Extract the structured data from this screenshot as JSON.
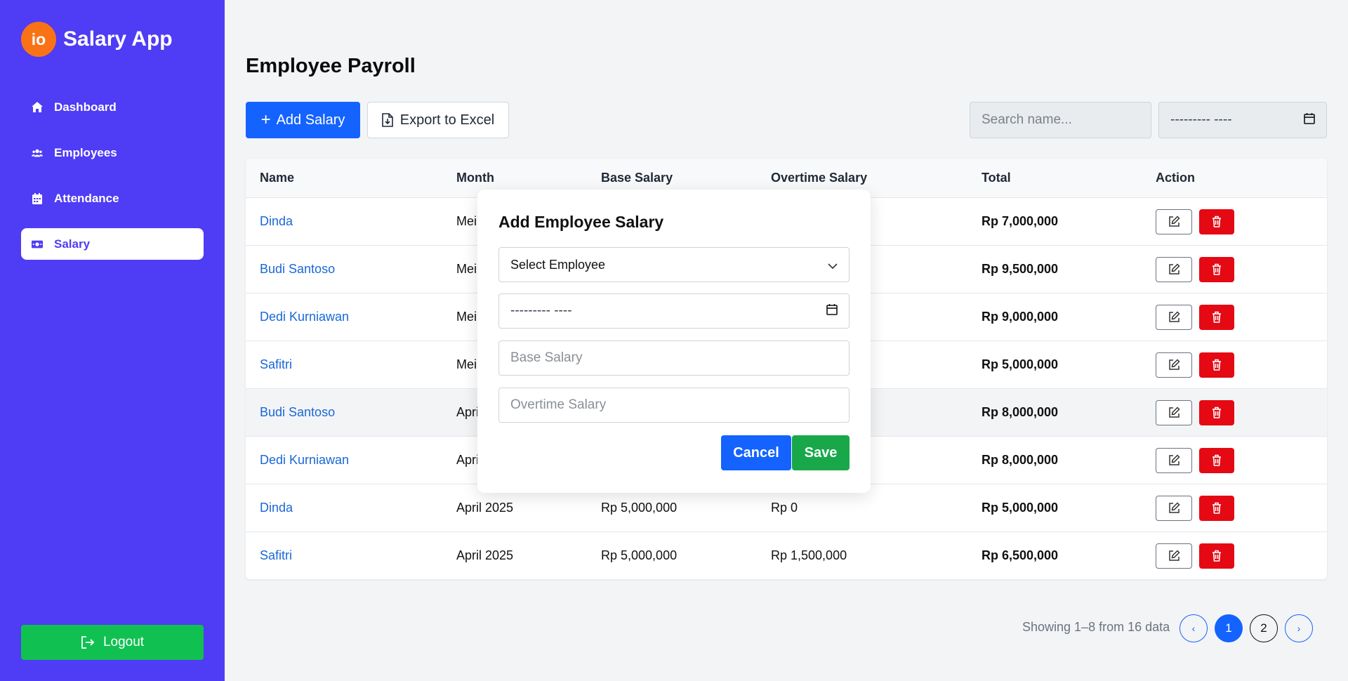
{
  "app": {
    "logo_text": "io",
    "title": "Salary App"
  },
  "sidebar": {
    "items": [
      {
        "label": "Dashboard",
        "icon": "home-icon",
        "active": false
      },
      {
        "label": "Employees",
        "icon": "users-icon",
        "active": false
      },
      {
        "label": "Attendance",
        "icon": "calendar-icon",
        "active": false
      },
      {
        "label": "Salary",
        "icon": "money-icon",
        "active": true
      }
    ],
    "logout_label": "Logout"
  },
  "page": {
    "title": "Employee Payroll"
  },
  "toolbar": {
    "add_label": "Add Salary",
    "export_label": "Export to Excel",
    "search_placeholder": "Search name...",
    "month_filter_value": "--------- ----"
  },
  "table": {
    "headers": [
      "Name",
      "Month",
      "Base Salary",
      "Overtime Salary",
      "Total",
      "Action"
    ],
    "rows": [
      {
        "name": "Dinda",
        "month": "Mei",
        "total": "Rp 7,000,000"
      },
      {
        "name": "Budi Santoso",
        "month": "Mei",
        "total": "Rp 9,500,000"
      },
      {
        "name": "Dedi Kurniawan",
        "month": "Mei",
        "total": "Rp 9,000,000"
      },
      {
        "name": "Safitri",
        "month": "Mei",
        "total": "Rp 5,000,000"
      },
      {
        "name": "Budi Santoso",
        "month": "Apri",
        "total": "Rp 8,000,000"
      },
      {
        "name": "Dedi Kurniawan",
        "month": "Apri",
        "total": "Rp 8,000,000"
      },
      {
        "name": "Dinda",
        "month": "April 2025",
        "base": "Rp 5,000,000",
        "overtime": "Rp 0",
        "total": "Rp 5,000,000"
      },
      {
        "name": "Safitri",
        "month": "April 2025",
        "base": "Rp 5,000,000",
        "overtime": "Rp 1,500,000",
        "total": "Rp 6,500,000"
      }
    ]
  },
  "pagination": {
    "info": "Showing 1–8 from 16 data",
    "prev": "‹",
    "pages": [
      "1",
      "2"
    ],
    "next": "›",
    "current": "1"
  },
  "modal": {
    "title": "Add Employee Salary",
    "employee_select": "Select Employee",
    "month_value": "--------- ----",
    "base_placeholder": "Base Salary",
    "overtime_placeholder": "Overtime Salary",
    "cancel_label": "Cancel",
    "save_label": "Save"
  },
  "colors": {
    "sidebar": "#4f3cf5",
    "primary": "#1463ff",
    "success": "#10c152",
    "danger": "#e50914",
    "logo": "#f97316"
  }
}
